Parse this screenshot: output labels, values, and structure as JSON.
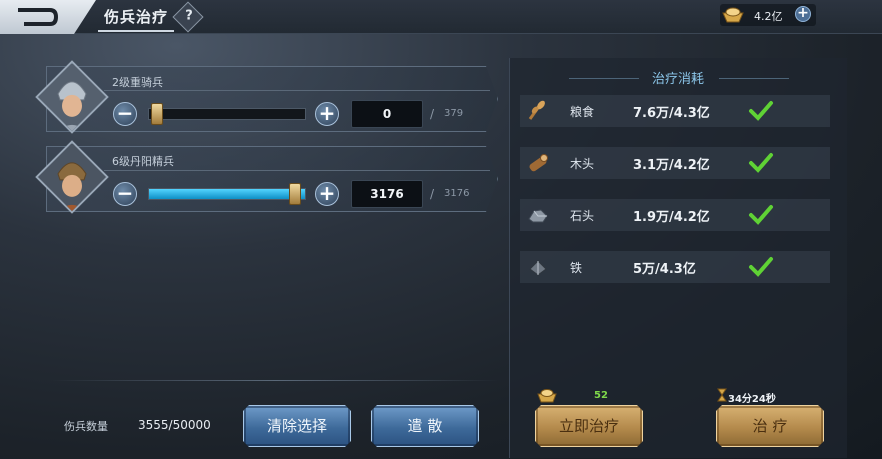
{
  "header": {
    "title": "伤兵治疗",
    "help": "?",
    "resource_value": "4.2亿",
    "resource_plus": "+"
  },
  "troops": [
    {
      "name": "2级重骑兵",
      "selected": "0",
      "max": "379",
      "fill_fraction": 0.0
    },
    {
      "name": "6级丹阳精兵",
      "selected": "3176",
      "max": "3176",
      "fill_fraction": 1.0
    }
  ],
  "controls": {
    "minus": "−",
    "plus": "+",
    "slash": "/"
  },
  "cost_panel": {
    "header": "治疗消耗",
    "items": [
      {
        "name": "粮食",
        "value": "7.6万/4.3亿",
        "icon": "grain-icon"
      },
      {
        "name": "木头",
        "value": "3.1万/4.2亿",
        "icon": "wood-icon"
      },
      {
        "name": "石头",
        "value": "1.9万/4.2亿",
        "icon": "stone-icon"
      },
      {
        "name": "铁",
        "value": "5万/4.3亿",
        "icon": "iron-icon"
      }
    ]
  },
  "footer": {
    "wounded_label": "伤兵数量",
    "wounded_value": "3555/50000",
    "clear_button": "清除选择",
    "dismiss_button": "遣 散",
    "instant_heal_button": "立即治疗",
    "instant_heal_cost": "52",
    "heal_button": "治 疗",
    "heal_time": "34分24秒"
  },
  "colors": {
    "accent_blue": "#53d4ff",
    "check_green": "#5fd235",
    "gold": "#d7b172"
  }
}
